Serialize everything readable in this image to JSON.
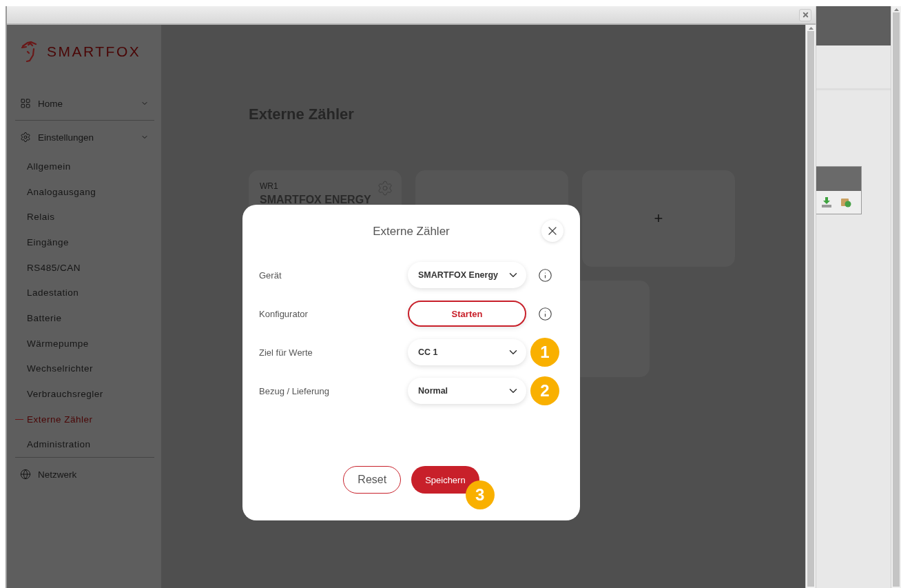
{
  "sidebar": {
    "brand": "SMARTFOX",
    "sections": [
      {
        "label": "Home"
      },
      {
        "label": "Einstellungen",
        "children": [
          {
            "label": "Allgemein",
            "selected": false
          },
          {
            "label": "Analogausgang",
            "selected": false
          },
          {
            "label": "Relais",
            "selected": false
          },
          {
            "label": "Eingänge",
            "selected": false
          },
          {
            "label": "RS485/CAN",
            "selected": false
          },
          {
            "label": "Ladestation",
            "selected": false
          },
          {
            "label": "Batterie",
            "selected": false
          },
          {
            "label": "Wärmepumpe",
            "selected": false
          },
          {
            "label": "Wechselrichter",
            "selected": false
          },
          {
            "label": "Verbrauchsregler",
            "selected": false
          },
          {
            "label": "Externe Zähler",
            "selected": true
          },
          {
            "label": "Administration",
            "selected": false
          }
        ]
      },
      {
        "label": "Netzwerk"
      }
    ]
  },
  "page": {
    "title": "Externe Zähler",
    "cards": [
      {
        "kind": "meter",
        "caption": "WR1",
        "name": "SMARTFOX ENERGY"
      },
      {
        "kind": "empty"
      },
      {
        "kind": "add",
        "label": "+"
      }
    ],
    "second_row_cards": [
      {
        "kind": "empty"
      }
    ]
  },
  "dialog": {
    "title": "Externe Zähler",
    "rows": [
      {
        "label": "Gerät",
        "kind": "select",
        "value": "SMARTFOX Energy",
        "info": true
      },
      {
        "label": "Konfigurator",
        "kind": "button",
        "value": "Starten",
        "info": true
      },
      {
        "label": "Ziel für Werte",
        "kind": "select",
        "value": "CC 1",
        "annotation": "1"
      },
      {
        "label": "Bezug / Lieferung",
        "kind": "select",
        "value": "Normal",
        "annotation": "2"
      }
    ],
    "buttons": [
      {
        "label": "Reset",
        "kind": "secondary"
      },
      {
        "label": "Speichern",
        "kind": "primary",
        "annotation": "3"
      }
    ]
  }
}
